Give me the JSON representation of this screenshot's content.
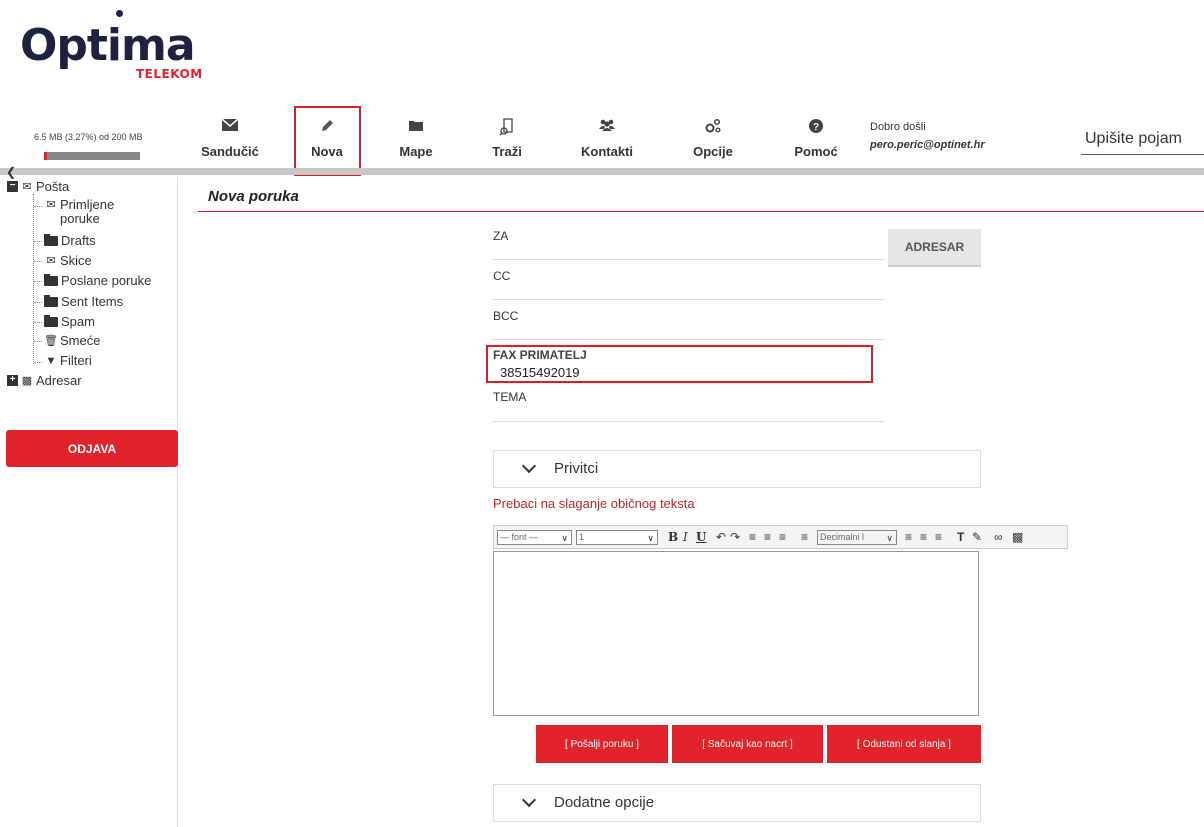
{
  "logo": {
    "word": "Optima",
    "sub": "TELEKOM"
  },
  "quota": {
    "text": "6.5 MB (3.27%) od 200 MB",
    "percent": 3.27
  },
  "toolbar": [
    {
      "key": "inbox",
      "label": "Sandučić",
      "icon": "envelope-icon"
    },
    {
      "key": "new",
      "label": "Nova",
      "icon": "pencil-icon"
    },
    {
      "key": "folders",
      "label": "Mape",
      "icon": "folder-icon"
    },
    {
      "key": "search",
      "label": "Traži",
      "icon": "search-doc-icon"
    },
    {
      "key": "contacts",
      "label": "Kontakti",
      "icon": "users-icon"
    },
    {
      "key": "options",
      "label": "Opcije",
      "icon": "gears-icon"
    },
    {
      "key": "help",
      "label": "Pomoć",
      "icon": "question-icon"
    }
  ],
  "user": {
    "welcome": "Dobro došli",
    "email": "pero.peric@optinet.hr"
  },
  "search": {
    "placeholder": "Upišite pojam"
  },
  "sidebar": {
    "root": "Pošta",
    "folders": [
      "Primljene poruke",
      "Drafts",
      "Skice",
      "Poslane poruke",
      "Sent Items",
      "Spam",
      "Smeće",
      "Filteri"
    ],
    "addressbook": "Adresar",
    "logout": "ODJAVA"
  },
  "compose": {
    "title": "Nova poruka",
    "to_label": "ZA",
    "cc_label": "CC",
    "bcc_label": "BCC",
    "fax_label": "FAX PRIMATELJ",
    "fax_value": "38515492019",
    "subject_label": "TEMA",
    "addressbook_button": "ADRESAR",
    "attachments": "Privitci",
    "plain_text_link": "Prebaci na slaganje običnog teksta",
    "font_select": "— font —",
    "size_select": "1",
    "list_select": "Decimalni l",
    "send": "[ Pošalji poruku ]",
    "save_draft": "[ Sačuvaj kao nacrt ]",
    "cancel": "[ Odustani od slanja ]",
    "more_options": "Dodatne opcije"
  },
  "colors": {
    "brand_red": "#e2232b",
    "logo_navy": "#1d2240",
    "highlight": "#d42027"
  }
}
